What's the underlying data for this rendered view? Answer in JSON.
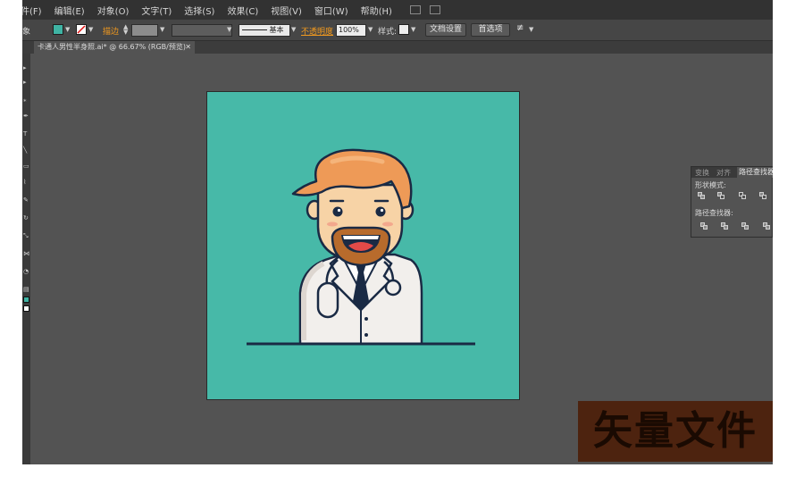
{
  "menu": {
    "items": [
      "件(F)",
      "编辑(E)",
      "对象(O)",
      "文字(T)",
      "选择(S)",
      "效果(C)",
      "视图(V)",
      "窗口(W)",
      "帮助(H)"
    ]
  },
  "controlbar": {
    "selection_label": "象",
    "stroke_label": "描边",
    "brush_label": "基本",
    "opacity_label": "不透明度",
    "opacity_value": "100%",
    "style_label": "样式:",
    "doc_setup_button": "文档设置",
    "preferences_button": "首选项",
    "fill_color": "#3fb3a3"
  },
  "document": {
    "tab_title": "卡通人男性半身照.ai* @ 66.67% (RGB/预览)",
    "close_glyph": "✕"
  },
  "pathfinder_panel": {
    "tabs": [
      "变换",
      "对齐",
      "路径查找器"
    ],
    "shape_modes_label": "形状模式:",
    "pathfinders_label": "路径查找器:"
  },
  "artwork": {
    "background_color": "#47b9a8",
    "hair_color": "#ee9a57",
    "skin_color": "#f7d3a6",
    "beard_color": "#b86b2c",
    "coat_color": "#f2efec",
    "outline_color": "#1a2a44"
  },
  "watermark": {
    "text": "矢量文件"
  }
}
